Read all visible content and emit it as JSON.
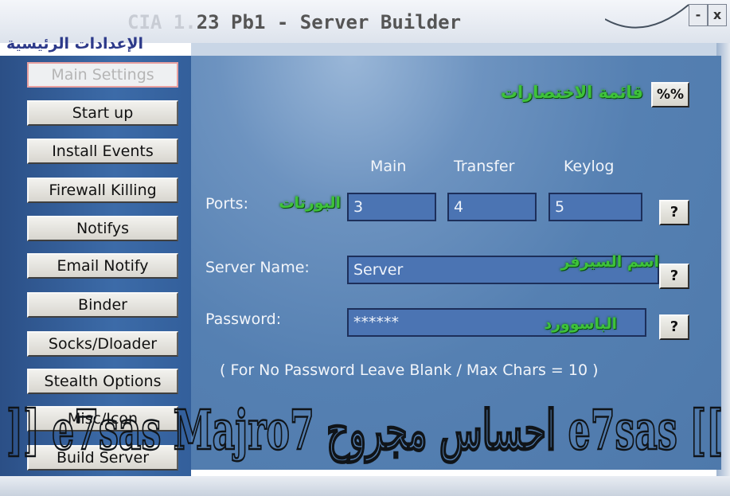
{
  "window": {
    "title_prefix": "CIA 1.",
    "title_main": "23 Pb1 - Server Builder",
    "minimize": "-",
    "close": "x"
  },
  "header": {
    "arabic_title": "الإعدادات الرئيسية"
  },
  "sidebar": {
    "items": [
      {
        "label": "Main Settings"
      },
      {
        "label": "Start up"
      },
      {
        "label": "Install Events"
      },
      {
        "label": "Firewall Killing"
      },
      {
        "label": "Notifys"
      },
      {
        "label": "Email Notify"
      },
      {
        "label": "Binder"
      },
      {
        "label": "Socks/Dloader"
      },
      {
        "label": "Stealth Options"
      },
      {
        "label": "Misc/Icon"
      },
      {
        "label": "Build Server"
      }
    ]
  },
  "main": {
    "shortcuts_button": "%%",
    "shortcuts_arabic": "قائمة الاختصارات",
    "ports": {
      "label": "Ports:",
      "arabic": "البورتات",
      "headers": {
        "main": "Main",
        "transfer": "Transfer",
        "keylog": "Keylog"
      },
      "values": {
        "main": "3",
        "transfer": "4",
        "keylog": "5"
      },
      "help": "?"
    },
    "server_name": {
      "label": "Server Name:",
      "value": "Server",
      "arabic": "اسم السيرفر",
      "help": "?"
    },
    "password": {
      "label": "Password:",
      "value": "******",
      "arabic": "الباسوورد",
      "help": "?"
    },
    "note": "( For No Password Leave Blank / Max Chars = 10 )"
  },
  "watermark": {
    "text": "]] e7sas Majro7 احساس مجروح e7sas [["
  },
  "colors": {
    "panel": "#5580b2",
    "sidebar": "#335f9b",
    "arabic_green": "#3ec23a",
    "field": "#4b74b3"
  }
}
